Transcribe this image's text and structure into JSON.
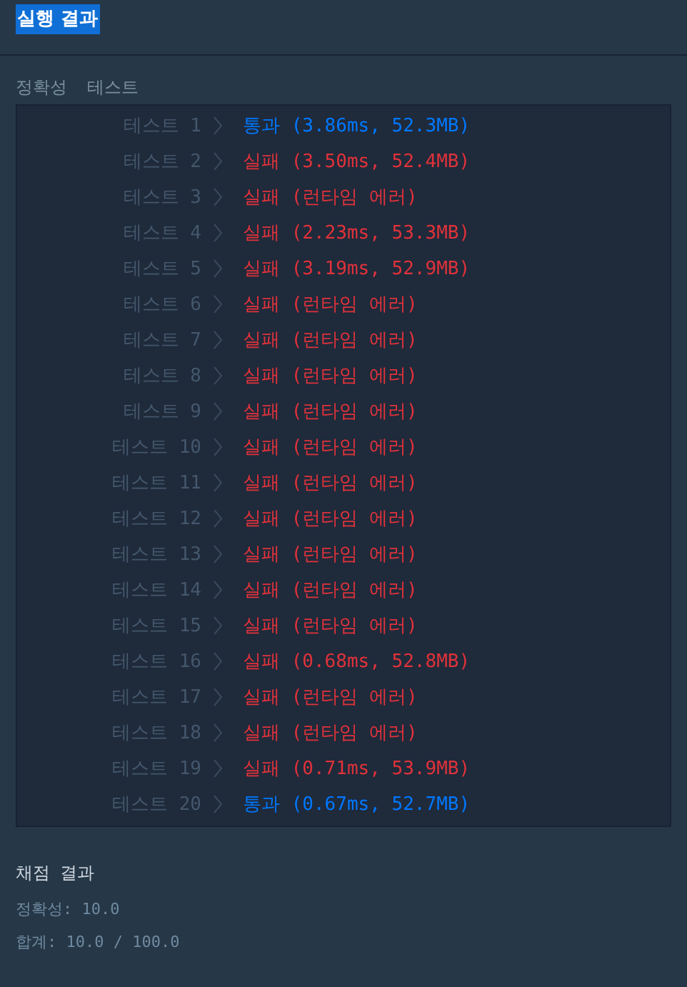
{
  "title": "실행 결과",
  "section_labels": [
    "정확성",
    "테스트"
  ],
  "tests": [
    {
      "label": "테스트 1",
      "kind": "pass",
      "result": "통과",
      "detail": "(3.86ms, 52.3MB)"
    },
    {
      "label": "테스트 2",
      "kind": "fail",
      "result": "실패",
      "detail": "(3.50ms, 52.4MB)"
    },
    {
      "label": "테스트 3",
      "kind": "fail",
      "result": "실패",
      "detail": "(런타임 에러)"
    },
    {
      "label": "테스트 4",
      "kind": "fail",
      "result": "실패",
      "detail": "(2.23ms, 53.3MB)"
    },
    {
      "label": "테스트 5",
      "kind": "fail",
      "result": "실패",
      "detail": "(3.19ms, 52.9MB)"
    },
    {
      "label": "테스트 6",
      "kind": "fail",
      "result": "실패",
      "detail": "(런타임 에러)"
    },
    {
      "label": "테스트 7",
      "kind": "fail",
      "result": "실패",
      "detail": "(런타임 에러)"
    },
    {
      "label": "테스트 8",
      "kind": "fail",
      "result": "실패",
      "detail": "(런타임 에러)"
    },
    {
      "label": "테스트 9",
      "kind": "fail",
      "result": "실패",
      "detail": "(런타임 에러)"
    },
    {
      "label": "테스트 10",
      "kind": "fail",
      "result": "실패",
      "detail": "(런타임 에러)"
    },
    {
      "label": "테스트 11",
      "kind": "fail",
      "result": "실패",
      "detail": "(런타임 에러)"
    },
    {
      "label": "테스트 12",
      "kind": "fail",
      "result": "실패",
      "detail": "(런타임 에러)"
    },
    {
      "label": "테스트 13",
      "kind": "fail",
      "result": "실패",
      "detail": "(런타임 에러)"
    },
    {
      "label": "테스트 14",
      "kind": "fail",
      "result": "실패",
      "detail": "(런타임 에러)"
    },
    {
      "label": "테스트 15",
      "kind": "fail",
      "result": "실패",
      "detail": "(런타임 에러)"
    },
    {
      "label": "테스트 16",
      "kind": "fail",
      "result": "실패",
      "detail": "(0.68ms, 52.8MB)"
    },
    {
      "label": "테스트 17",
      "kind": "fail",
      "result": "실패",
      "detail": "(런타임 에러)"
    },
    {
      "label": "테스트 18",
      "kind": "fail",
      "result": "실패",
      "detail": "(런타임 에러)"
    },
    {
      "label": "테스트 19",
      "kind": "fail",
      "result": "실패",
      "detail": "(0.71ms, 53.9MB)"
    },
    {
      "label": "테스트 20",
      "kind": "pass",
      "result": "통과",
      "detail": "(0.67ms, 52.7MB)"
    }
  ],
  "grading": {
    "title": "채점 결과",
    "lines": [
      "정확성: 10.0",
      "합계: 10.0 / 100.0"
    ]
  }
}
